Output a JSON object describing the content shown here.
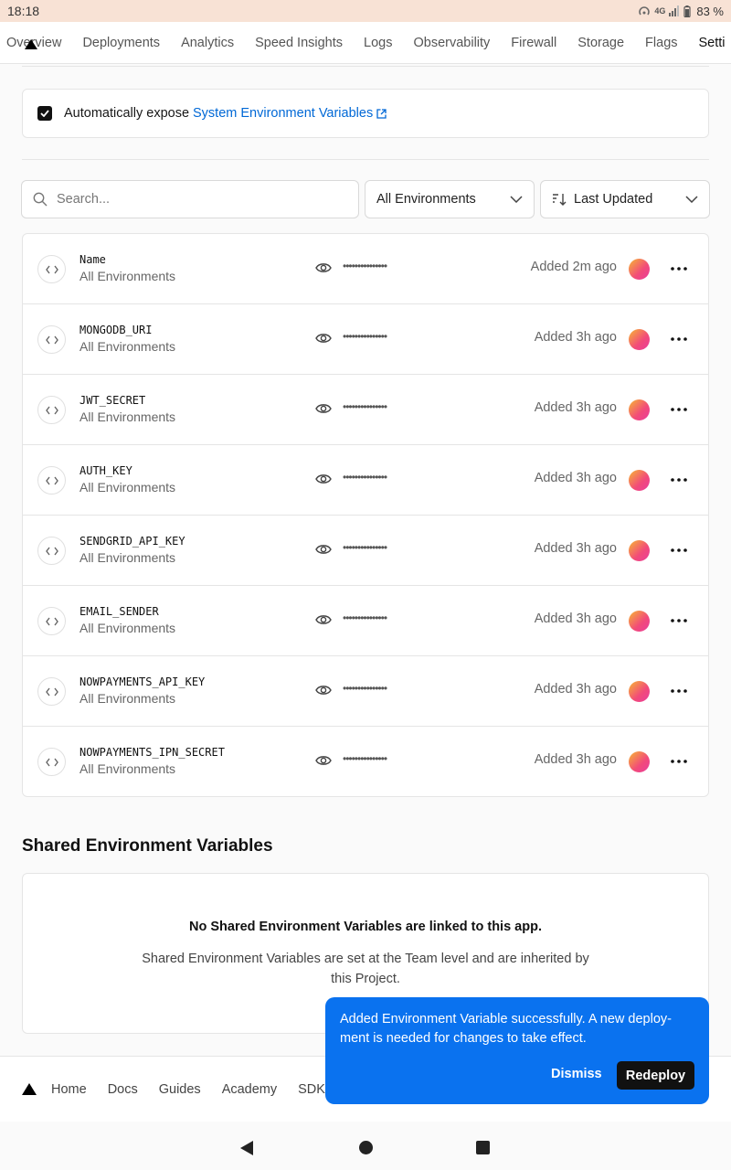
{
  "status_bar": {
    "time": "18:18",
    "network": "4G",
    "battery": "83 %"
  },
  "tabs": [
    {
      "label": "Overview",
      "active": false
    },
    {
      "label": "Deployments",
      "active": false
    },
    {
      "label": "Analytics",
      "active": false
    },
    {
      "label": "Speed Insights",
      "active": false
    },
    {
      "label": "Logs",
      "active": false
    },
    {
      "label": "Observability",
      "active": false
    },
    {
      "label": "Firewall",
      "active": false
    },
    {
      "label": "Storage",
      "active": false
    },
    {
      "label": "Flags",
      "active": false
    },
    {
      "label": "Setti",
      "active": true
    }
  ],
  "expose": {
    "label": "Automatically expose",
    "link": "System Environment Variables",
    "checked": true
  },
  "filters": {
    "search_placeholder": "Search...",
    "environment": "All Environments",
    "sort": "Last Updated"
  },
  "env_vars": [
    {
      "name": "Name",
      "scope": "All Environments",
      "value": "•••••••••••••••",
      "added": "Added 2m ago"
    },
    {
      "name": "MONGODB_URI",
      "scope": "All Environments",
      "value": "•••••••••••••••",
      "added": "Added 3h ago"
    },
    {
      "name": "JWT_SECRET",
      "scope": "All Environments",
      "value": "•••••••••••••••",
      "added": "Added 3h ago"
    },
    {
      "name": "AUTH_KEY",
      "scope": "All Environments",
      "value": "•••••••••••••••",
      "added": "Added 3h ago"
    },
    {
      "name": "SENDGRID_API_KEY",
      "scope": "All Environments",
      "value": "•••••••••••••••",
      "added": "Added 3h ago"
    },
    {
      "name": "EMAIL_SENDER",
      "scope": "All Environments",
      "value": "•••••••••••••••",
      "added": "Added 3h ago"
    },
    {
      "name": "NOWPAYMENTS_API_KEY",
      "scope": "All Environments",
      "value": "•••••••••••••••",
      "added": "Added 3h ago"
    },
    {
      "name": "NOWPAYMENTS_IPN_SECRET",
      "scope": "All Environments",
      "value": "•••••••••••••••",
      "added": "Added 3h ago"
    }
  ],
  "shared": {
    "title": "Shared Environment Variables",
    "empty_heading": "No Shared Environment Variables are linked to this app.",
    "empty_text": "Shared Environment Variables are set at the Team level and are inherited by this Project."
  },
  "footer": {
    "links": [
      "Home",
      "Docs",
      "Guides",
      "Academy",
      "SDKs"
    ]
  },
  "toast": {
    "message": "Added Environment Variable successfully. A new deploy-ment is needed for changes to take effect.",
    "dismiss": "Dismiss",
    "redeploy": "Redeploy"
  },
  "colors": {
    "accent": "#0a72ef",
    "link": "#0068d6",
    "toast_bg": "#0a72ef"
  }
}
